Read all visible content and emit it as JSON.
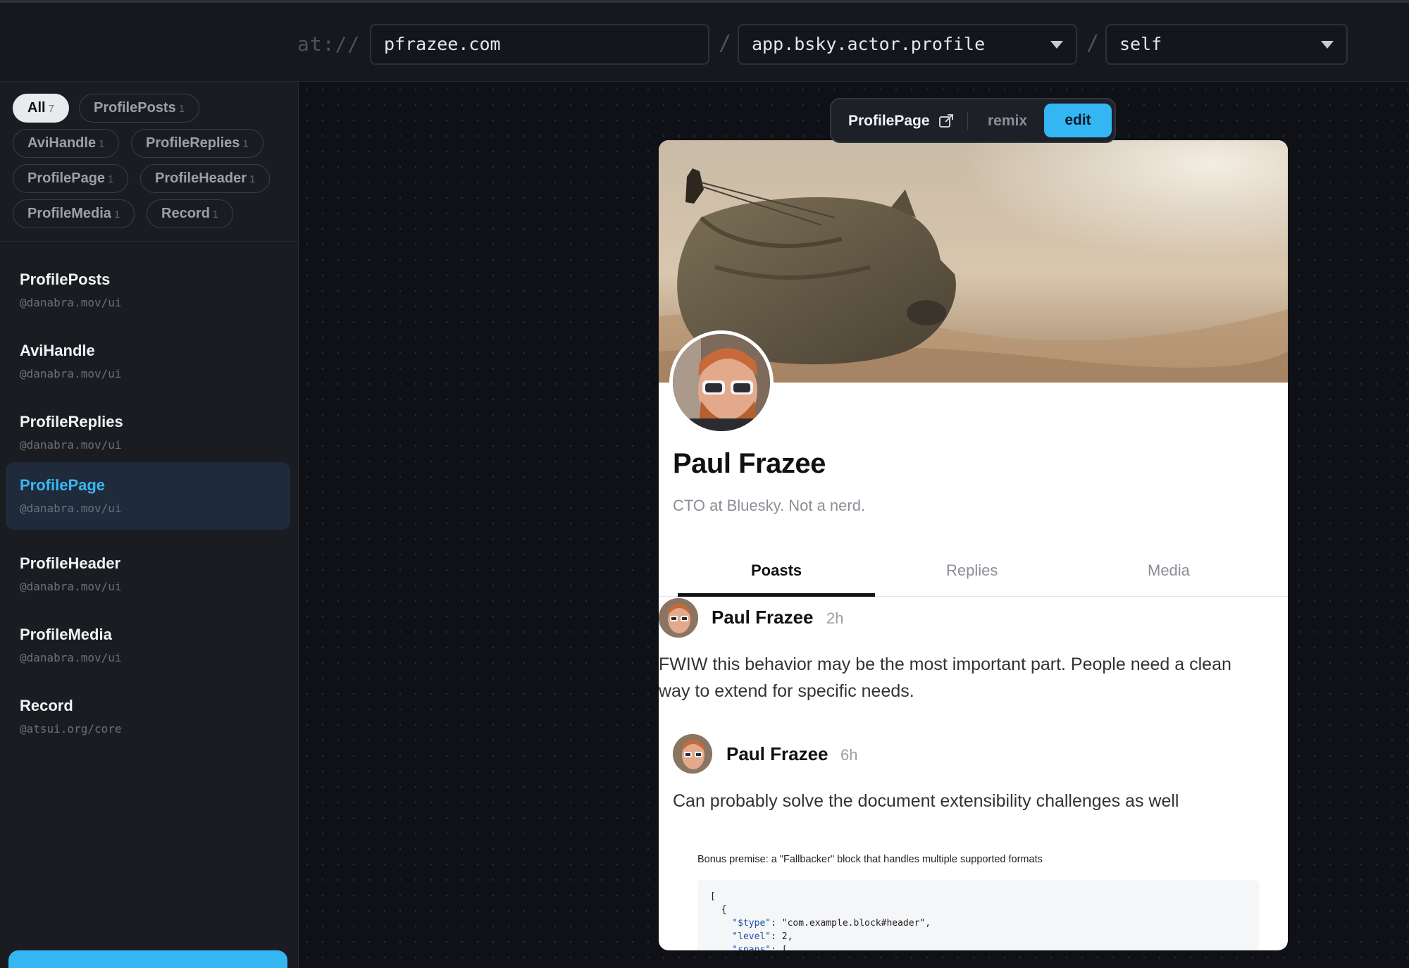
{
  "address_bar": {
    "prefix": "at://",
    "handle": "pfrazee.com",
    "collection": "app.bsky.actor.profile",
    "rkey": "self",
    "separator": "/"
  },
  "filters": [
    {
      "label": "All",
      "count": "7",
      "active": true
    },
    {
      "label": "ProfilePosts",
      "count": "1"
    },
    {
      "label": "AviHandle",
      "count": "1"
    },
    {
      "label": "ProfileReplies",
      "count": "1"
    },
    {
      "label": "ProfilePage",
      "count": "1"
    },
    {
      "label": "ProfileHeader",
      "count": "1"
    },
    {
      "label": "ProfileMedia",
      "count": "1"
    },
    {
      "label": "Record",
      "count": "1"
    }
  ],
  "components": [
    {
      "name": "ProfilePosts",
      "source": "@danabra.mov/ui"
    },
    {
      "name": "AviHandle",
      "source": "@danabra.mov/ui"
    },
    {
      "name": "ProfileReplies",
      "source": "@danabra.mov/ui"
    },
    {
      "name": "ProfilePage",
      "source": "@danabra.mov/ui",
      "selected": true
    },
    {
      "name": "ProfileHeader",
      "source": "@danabra.mov/ui"
    },
    {
      "name": "ProfileMedia",
      "source": "@danabra.mov/ui"
    },
    {
      "name": "Record",
      "source": "@atsui.org/core"
    }
  ],
  "component_toolbar": {
    "name": "ProfilePage",
    "remix": "remix",
    "edit": "edit"
  },
  "profile": {
    "display_name": "Paul Frazee",
    "bio": "CTO at Bluesky. Not a nerd.",
    "tabs": [
      "Poasts",
      "Replies",
      "Media"
    ],
    "active_tab": "Poasts"
  },
  "posts": [
    {
      "author": "Paul Frazee",
      "time": "2h",
      "text_line1": "FWIW this behavior may be the most important part. People need a clean",
      "text_line2": "way to extend for specific needs."
    },
    {
      "author": "Paul Frazee",
      "time": "6h",
      "text": "Can probably solve the document extensibility challenges as well",
      "quote_title": "Bonus premise: a \"Fallbacker\" block that handles multiple supported formats",
      "code": {
        "l1": "[",
        "l2": "  {",
        "l3_key": "    \"$type\"",
        "l3_val": ": \"com.example.block#header\",",
        "l4_key": "    \"level\"",
        "l4_val": ": 2,",
        "l5_key": "    \"spans\"",
        "l5_val": ": ["
      }
    }
  ],
  "colors": {
    "accent": "#34b6f3",
    "background": "#101116",
    "sidebar": "#1a1c21",
    "selected_item": "#1f2b3b"
  }
}
